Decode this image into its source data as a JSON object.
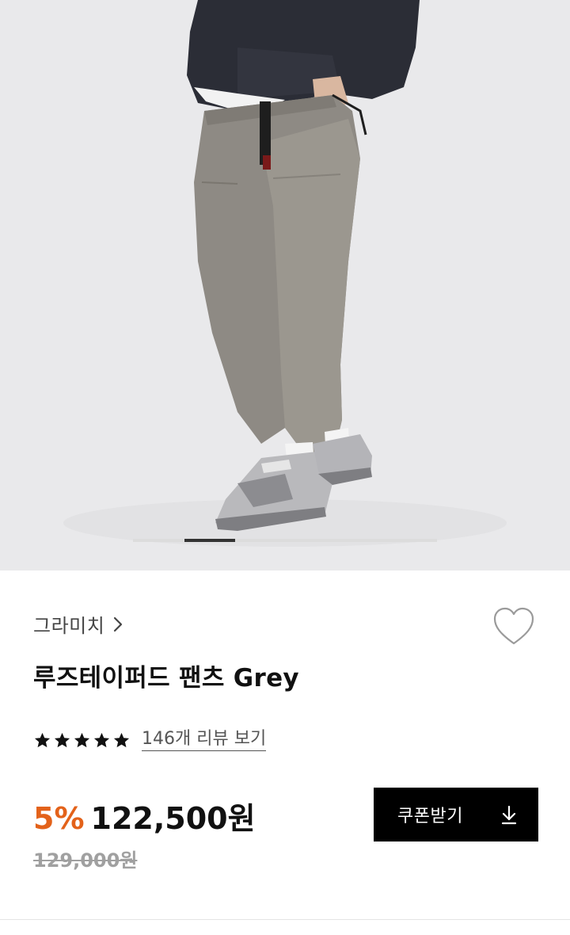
{
  "product_image": {
    "icon": "product-photo-grey-pants",
    "background_color": "#e9e9eb",
    "carousel": {
      "total_slides": 6,
      "active_slide": 2
    }
  },
  "brand": {
    "name": "그라미치",
    "chevron_icon": "chevron-right-icon"
  },
  "wishlist": {
    "icon": "heart-outline-icon"
  },
  "product": {
    "title": "루즈테이퍼드 팬츠 Grey"
  },
  "rating": {
    "stars": 5,
    "max_stars": 5,
    "review_link_label": "146개 리뷰 보기"
  },
  "pricing": {
    "discount_label": "5%",
    "sale_price": "122,500원",
    "original_price": "129,000원",
    "discount_color": "#e3621a"
  },
  "coupon_button": {
    "label": "쿠폰받기",
    "icon": "download-icon"
  }
}
